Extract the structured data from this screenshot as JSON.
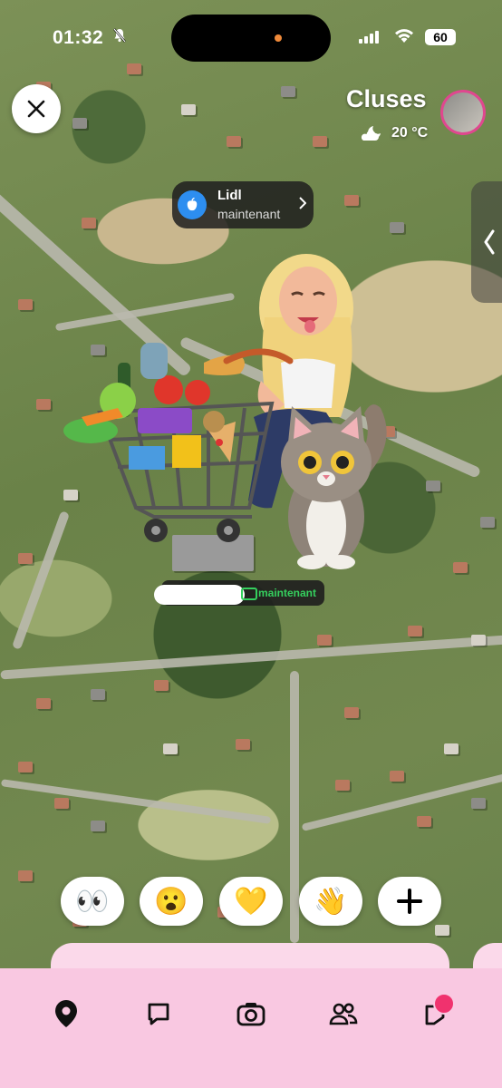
{
  "status_bar": {
    "time": "01:32",
    "battery": "60"
  },
  "location": {
    "city": "Cluses",
    "temperature": "20 °C"
  },
  "place_card": {
    "name": "Lidl",
    "time": "maintenant"
  },
  "friend_tag": {
    "time": "maintenant"
  },
  "reactions": [
    {
      "emoji": "👀",
      "name": "eyes-reaction"
    },
    {
      "emoji": "😮",
      "name": "surprised-reaction"
    },
    {
      "emoji": "💛",
      "name": "heart-reaction"
    },
    {
      "emoji": "👋",
      "name": "wave-reaction"
    },
    {
      "emoji": "+",
      "name": "add-reaction"
    }
  ],
  "nav": {
    "items": [
      "map-icon",
      "chat-icon",
      "camera-icon",
      "friends-icon",
      "stories-icon"
    ],
    "active": "map-icon"
  },
  "colors": {
    "nav_bg": "#f9c8e1",
    "badge": "#f0326e",
    "friend_time": "#35d05e",
    "avatar_ring": "#e0478f"
  }
}
